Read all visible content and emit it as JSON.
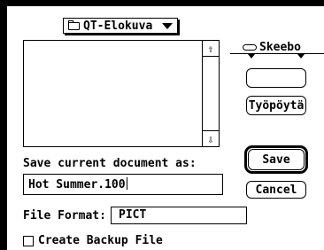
{
  "folder_popup": {
    "label": "QT-Elokuva",
    "icon": "folder-icon"
  },
  "drive": {
    "name": "Skeebo",
    "icon": "disk-icon"
  },
  "buttons": {
    "eject": "",
    "desktop": "Työpöytä",
    "save": "Save",
    "cancel": "Cancel"
  },
  "save_prompt": "Save current document as:",
  "filename": "Hot Summer.100",
  "file_format": {
    "label": "File Format:",
    "value": "PICT"
  },
  "backup": {
    "label": "Create Backup File",
    "checked": false
  }
}
